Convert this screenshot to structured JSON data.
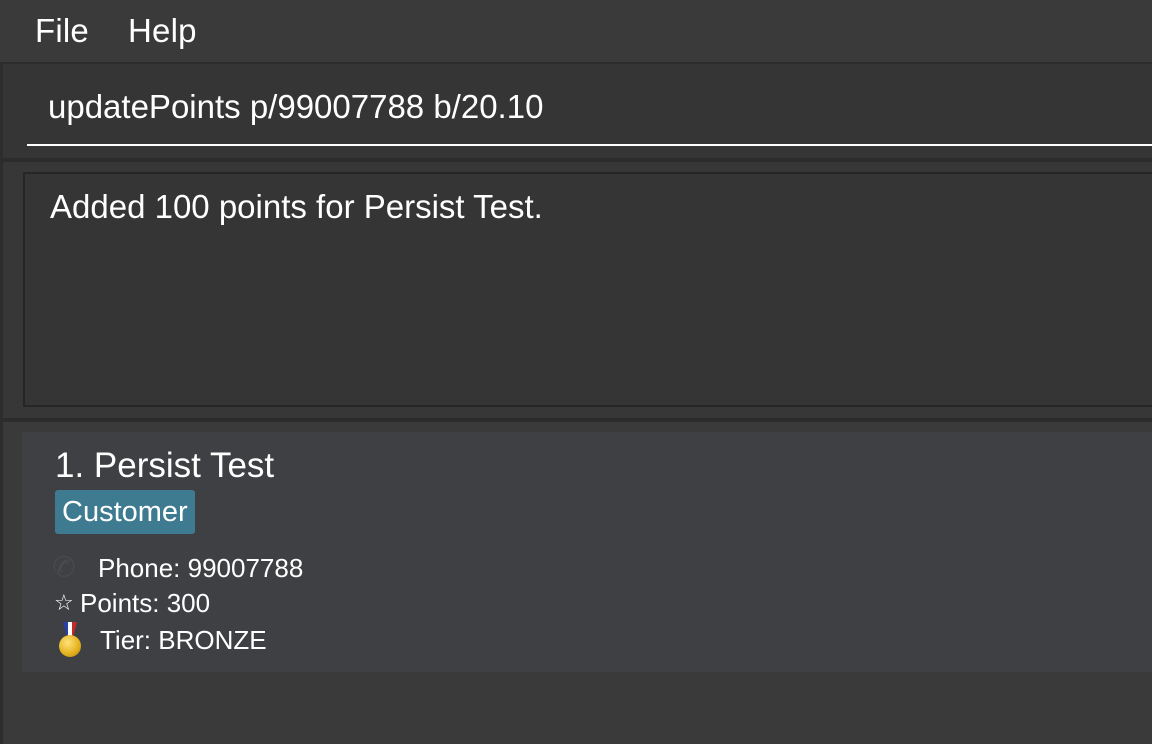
{
  "menu": {
    "file_label": "File",
    "help_label": "Help"
  },
  "command": {
    "value": "updatePoints p/99007788 b/20.10"
  },
  "result": {
    "message": "Added 100 points for Persist Test."
  },
  "person_list": [
    {
      "name": "1. Persist Test",
      "tag": "Customer",
      "phone": "Phone: 99007788",
      "points": "Points: 300",
      "tier": "Tier: BRONZE",
      "icons": {
        "phone": "phone-icon",
        "points": "star-icon",
        "tier": "medal-icon"
      }
    }
  ],
  "colors": {
    "tag_background": "#3e7b91",
    "card_background": "#3e4043",
    "window_background": "#3c3d3f"
  }
}
